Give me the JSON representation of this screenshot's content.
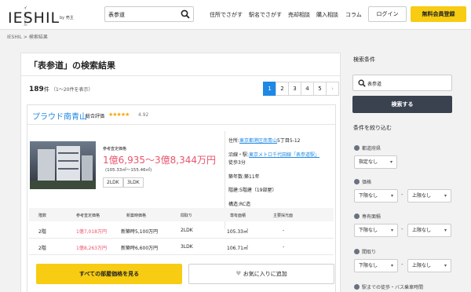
{
  "header": {
    "logo_ruby": "イエシル",
    "logo_main": "IESHIL",
    "logo_sub": "by 売主",
    "search_value": "表参道",
    "nav": [
      "住所でさがす",
      "駅名でさがす",
      "売却相談",
      "購入相談",
      "コラム"
    ],
    "login_label": "ログイン",
    "register_label": "無料会員登録"
  },
  "breadcrumb": "IESHIL > 検索結果",
  "main": {
    "title": "「表参道」の検索結果",
    "count_num": "189",
    "count_unit": "件",
    "count_range": "（1〜20件を表示）",
    "pages": [
      "1",
      "2",
      "3",
      "4",
      "5",
      "›"
    ]
  },
  "property": {
    "name": "プラウド南青山",
    "rating_label": "総合評価",
    "stars": "★★★★★",
    "rating_value": "4.92",
    "ref_price_label": "参考査定価格",
    "price_range": "1億6,935〜3億8,344万円",
    "price_per_m2": "(105.33㎡〜155.46㎡)",
    "tags": [
      "2LDK",
      "3LDK"
    ],
    "address_label": "住所:",
    "address_link": "東京都港区南青山",
    "address_rest": "5丁目5-12",
    "line_label": "沿線・駅:",
    "line_link": "東京メトロ千代田線",
    "station_link": "「表参道駅」",
    "walk": "徒歩3分",
    "age": "築年数:築11年",
    "floors": "階建:5階建（19部屋）",
    "structure": "構造:RC造"
  },
  "table": {
    "headers": [
      "階数",
      "参考査定価格",
      "新築時価格",
      "間取り",
      "専有面積",
      "主要採光面"
    ],
    "rows": [
      [
        "2階",
        "1億7,018万円",
        "新築時5,100万円",
        "2LDK",
        "105.33㎡",
        "-"
      ],
      [
        "2階",
        "1億8,263万円",
        "新築時6,600万円",
        "3LDK",
        "106.71㎡",
        "-"
      ]
    ]
  },
  "actions": {
    "view_all": "すべての部屋価格を見る",
    "favorite": "お気に入りに追加"
  },
  "sidebar": {
    "title": "検索条件",
    "search_value": "表参道",
    "search_button": "検索する",
    "refine_title": "条件を絞り込む",
    "pref_label": "都道府県",
    "pref_value": "指定なし",
    "price_label": "価格",
    "area_label": "専有面積",
    "layout_label": "間取り",
    "min_label": "下限なし",
    "max_label": "上限なし",
    "dash": "-",
    "walk_label": "駅までの徒歩・バス乗車時間"
  },
  "colors": {
    "accent_yellow": "#f7cc12",
    "link_blue": "#1e88e5",
    "price_red": "#e9546b",
    "dark_button": "#3a4250"
  }
}
